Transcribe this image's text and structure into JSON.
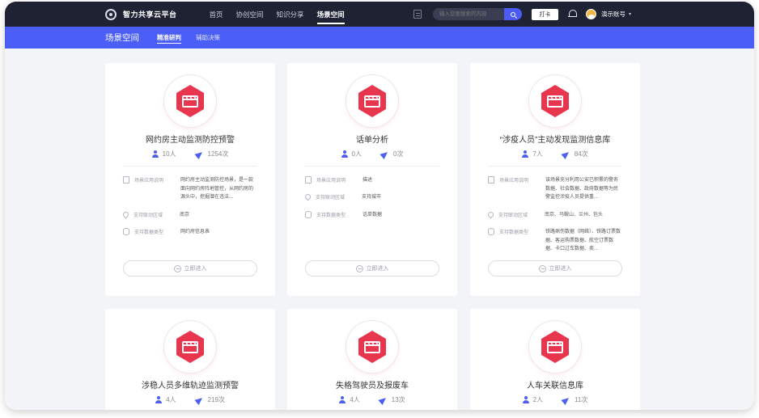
{
  "topbar": {
    "app_name": "智力共享云平台",
    "nav": [
      "首页",
      "协创空间",
      "知识分享",
      "场景空间"
    ],
    "search_placeholder": "输入您要搜索的内容",
    "checkin_label": "打卡",
    "account_label": "演示账号"
  },
  "subbar": {
    "title": "场景空间",
    "tabs": [
      "精准研判",
      "辅助决策"
    ]
  },
  "cards": [
    {
      "title": "网约房主动监测防控预警",
      "people": "10人",
      "visits": "1254次",
      "desc_label": "场景应用说明",
      "desc": "网约房主动监测防控场景，是一款面向网约房阵地管控，从网约房的源头中，挖掘潜在违法...",
      "region_label": "支持联动区域",
      "region": "南京",
      "data_label": "支持数据类型",
      "data_type": "网约房信息表",
      "enter_label": "立即进入"
    },
    {
      "title": "话单分析",
      "people": "0人",
      "visits": "0次",
      "desc_label": "场景应用说明",
      "desc": "描述",
      "region_label": "支持联动区域",
      "region": "支持城市",
      "data_label": "支持数据类型",
      "data_type": "话单数据",
      "enter_label": "立即进入"
    },
    {
      "title": "“涉疫人员”主动发现监测信息库",
      "people": "7人",
      "visits": "84次",
      "desc_label": "场景应用说明",
      "desc": "该场景充分利用公安已积累的警务数据、社会数据、政府数据等为民警监控涉疫人员提供重...",
      "region_label": "支持联动区域",
      "region": "南京、马鞍山、兰州、包头",
      "data_label": "支持数据类型",
      "data_type": "铁路病伤数据（网络）、铁路订票数据、客运购票数据、航空订票数据、卡口过车数据、卖...",
      "enter_label": "立即进入"
    },
    {
      "title": "涉稳人员多维轨迹监测预警",
      "people": "4人",
      "visits": "219次"
    },
    {
      "title": "失格驾驶员及报废车",
      "people": "4人",
      "visits": "13次"
    },
    {
      "title": "人车关联信息库",
      "people": "2人",
      "visits": "11次"
    }
  ],
  "colors": {
    "brand": "#4b5ef6",
    "topbar": "#1f2233",
    "icon_red": "#e8364f"
  }
}
